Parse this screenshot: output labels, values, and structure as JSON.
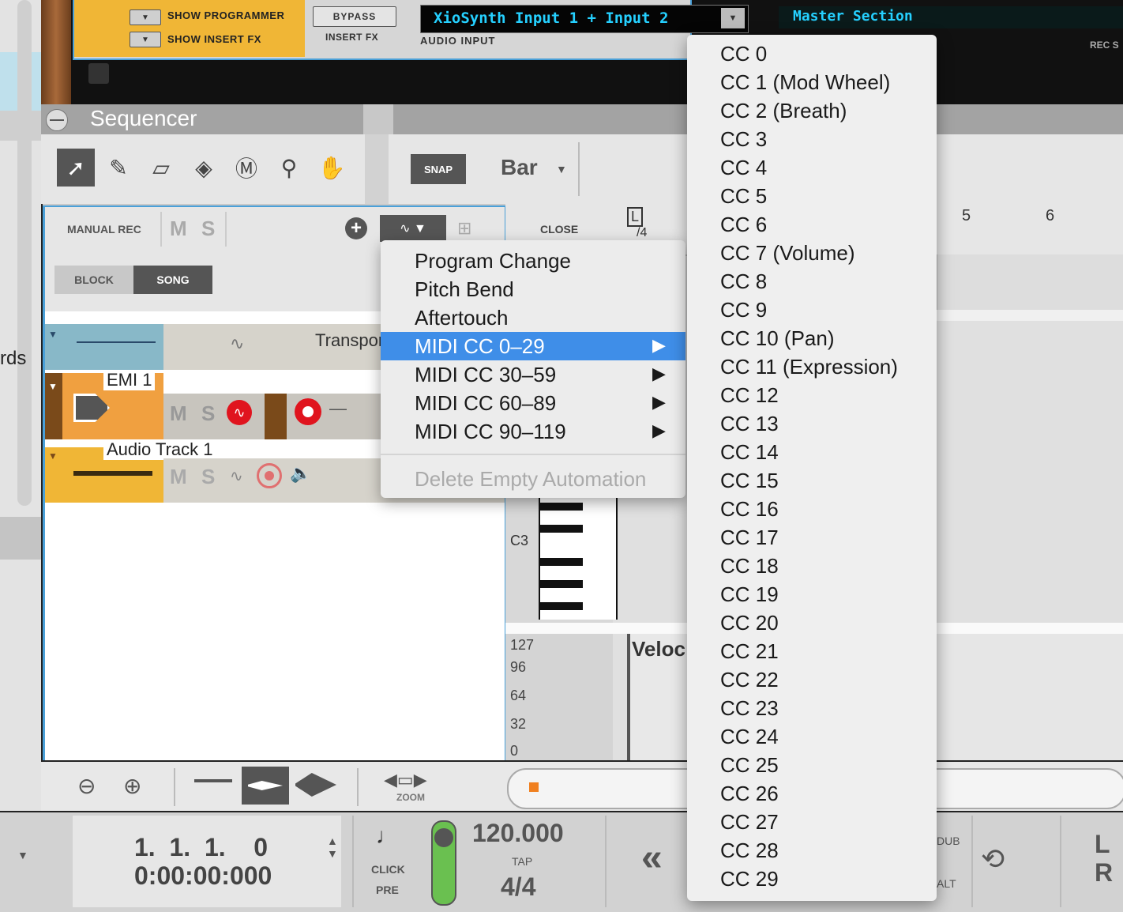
{
  "rack": {
    "show_programmer": "SHOW PROGRAMMER",
    "show_insert_fx": "SHOW INSERT FX",
    "bypass": "BYPASS",
    "insert_fx": "INSERT FX",
    "audio_input_value": "XioSynth Input 1 + Input 2",
    "audio_input_label": "AUDIO INPUT",
    "master_section": "Master Section",
    "rec_source": "REC S"
  },
  "left_strip": {
    "partial_text": "rds"
  },
  "sequencer": {
    "title": "Sequencer",
    "snap_label": "SNAP",
    "snap_value": "Bar",
    "manual_rec": "MANUAL REC",
    "mute": "M",
    "solo": "S",
    "block_tab": "BLOCK",
    "song_tab": "SONG",
    "close_label": "CLOSE",
    "loop_marker": "L",
    "time_sig_partial": "/4",
    "ruler": [
      "5",
      "6"
    ],
    "note_label": "C3",
    "velocity_label": "Veloc",
    "velocity_ticks": [
      "127",
      "96",
      "64",
      "32",
      "0"
    ],
    "zoom_label": "ZOOM"
  },
  "tracks": [
    {
      "name": "Transport"
    },
    {
      "name": "EMI 1"
    },
    {
      "name": "Audio Track 1"
    }
  ],
  "menu_main": {
    "items": [
      {
        "label": "Program Change",
        "submenu": false
      },
      {
        "label": "Pitch Bend",
        "submenu": false
      },
      {
        "label": "Aftertouch",
        "submenu": false
      },
      {
        "label": "MIDI CC 0–29",
        "submenu": true,
        "selected": true
      },
      {
        "label": "MIDI CC 30–59",
        "submenu": true
      },
      {
        "label": "MIDI CC 60–89",
        "submenu": true
      },
      {
        "label": "MIDI CC 90–119",
        "submenu": true
      }
    ],
    "delete_empty": "Delete Empty Automation",
    "arrow": "▶"
  },
  "menu_cc": {
    "items": [
      "CC 0",
      "CC 1 (Mod Wheel)",
      "CC 2 (Breath)",
      "CC 3",
      "CC 4",
      "CC 5",
      "CC 6",
      "CC 7 (Volume)",
      "CC 8",
      "CC 9",
      "CC 10 (Pan)",
      "CC 11 (Expression)",
      "CC 12",
      "CC 13",
      "CC 14",
      "CC 15",
      "CC 16",
      "CC 17",
      "CC 18",
      "CC 19",
      "CC 20",
      "CC 21",
      "CC 22",
      "CC 23",
      "CC 24",
      "CC 25",
      "CC 26",
      "CC 27",
      "CC 28",
      "CC 29"
    ]
  },
  "transport": {
    "position_bars": "1.  1.  1.    0",
    "position_time": "0:00:00:000",
    "click": "CLICK",
    "pre": "PRE",
    "tempo": "120.000",
    "tap": "TAP",
    "signature": "4/4",
    "rewind": "«",
    "dub": "DUB",
    "alt": "ALT",
    "l": "L",
    "r": "R"
  },
  "colors": {
    "accent": "#4aa0d8",
    "menu_highlight": "#3f8ee8",
    "yellow": "#f0b636",
    "orange": "#f0a040",
    "rec_red": "#e0141e"
  }
}
